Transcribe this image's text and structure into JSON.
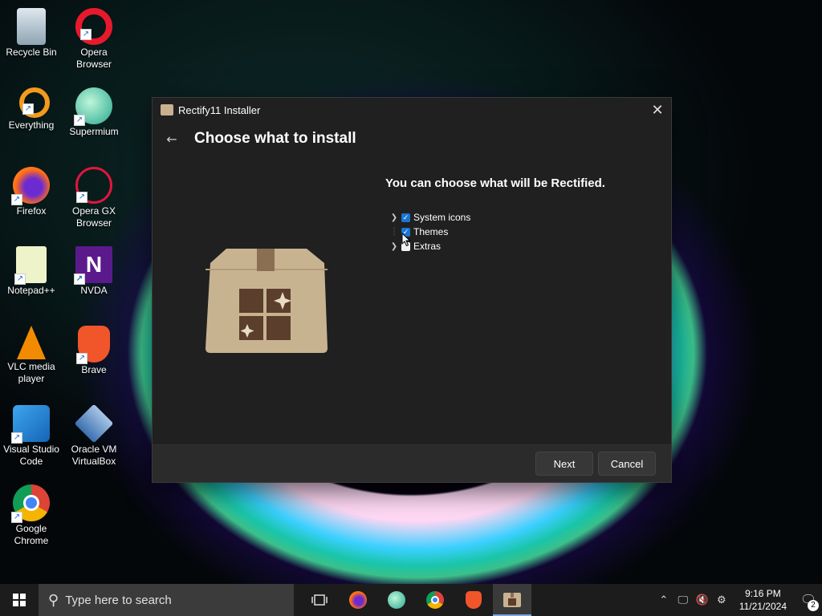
{
  "desktop": {
    "icons": [
      {
        "label": "Recycle Bin",
        "icon": "recycle-bin-icon"
      },
      {
        "label": "Opera\nBrowser",
        "icon": "opera-icon"
      },
      {
        "label": "Everything",
        "icon": "everything-icon"
      },
      {
        "label": "Supermium",
        "icon": "supermium-icon"
      },
      {
        "label": "Firefox",
        "icon": "firefox-icon"
      },
      {
        "label": "Opera GX\nBrowser",
        "icon": "opera-gx-icon"
      },
      {
        "label": "Notepad++",
        "icon": "notepadpp-icon"
      },
      {
        "label": "NVDA",
        "icon": "nvda-icon"
      },
      {
        "label": "VLC media\nplayer",
        "icon": "vlc-icon"
      },
      {
        "label": "Brave",
        "icon": "brave-icon"
      },
      {
        "label": "Visual Studio\nCode",
        "icon": "vscode-icon"
      },
      {
        "label": "Oracle VM\nVirtualBox",
        "icon": "virtualbox-icon"
      },
      {
        "label": "Google\nChrome",
        "icon": "chrome-icon"
      }
    ]
  },
  "dialog": {
    "title": "Rectify11 Installer",
    "heading": "Choose what to install",
    "subtitle": "You can choose what will be Rectified.",
    "tree": [
      {
        "label": "System icons",
        "checked": true,
        "expandable": true
      },
      {
        "label": "Themes",
        "checked": true,
        "expandable": false
      },
      {
        "label": "Extras",
        "checked": false,
        "expandable": true
      }
    ],
    "next_label": "Next",
    "cancel_label": "Cancel"
  },
  "taskbar": {
    "search_placeholder": "Type here to search",
    "apps": [
      "task-view-icon",
      "firefox-icon",
      "supermium-icon",
      "chrome-icon",
      "brave-icon",
      "rectify11-installer-icon"
    ],
    "time": "9:16 PM",
    "date": "11/21/2024",
    "notification_count": "2"
  },
  "colors": {
    "accent": "#1976d2",
    "dialog_bg": "#202020",
    "taskbar_bg": "#1c1c1c"
  }
}
